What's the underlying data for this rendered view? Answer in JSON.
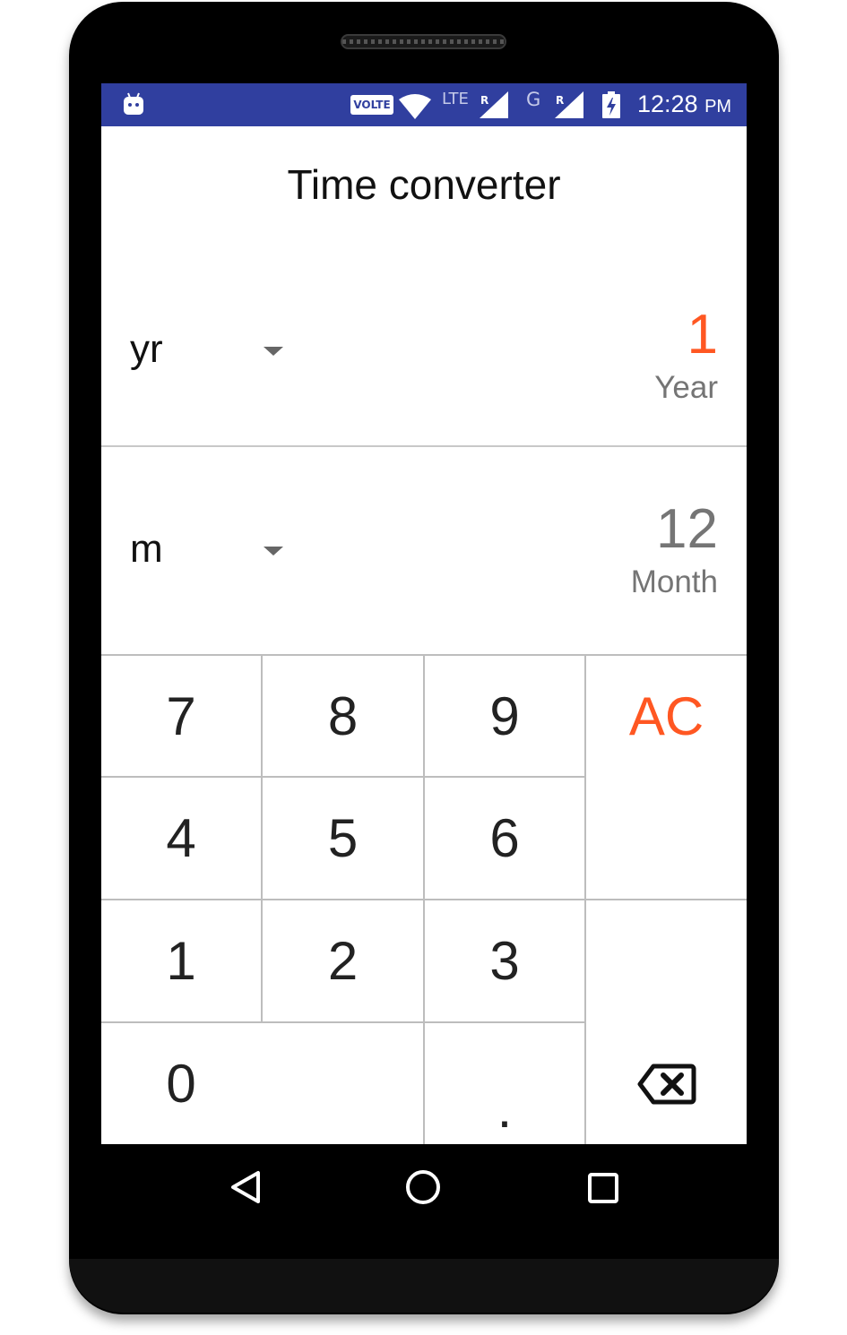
{
  "status_bar": {
    "volte": "VOLTE",
    "network1": "LTE",
    "roaming1": "R",
    "network2": "G",
    "roaming2": "R",
    "time": "12:28",
    "ampm": "PM",
    "background_color": "#303f9f"
  },
  "app": {
    "title": "Time converter",
    "accent_color": "#ff5722"
  },
  "converter": {
    "from": {
      "unit": "yr",
      "value": "1",
      "unit_name": "Year"
    },
    "to": {
      "unit": "m",
      "value": "12",
      "unit_name": "Month"
    }
  },
  "keypad": {
    "k7": "7",
    "k8": "8",
    "k9": "9",
    "ac": "AC",
    "k4": "4",
    "k5": "5",
    "k6": "6",
    "k1": "1",
    "k2": "2",
    "k3": "3",
    "k0": "0",
    "dot": ".",
    "backspace_icon": "backspace-icon"
  },
  "nav_bar": {
    "back_icon": "back-triangle-icon",
    "home_icon": "home-circle-icon",
    "recents_icon": "recents-square-icon"
  }
}
